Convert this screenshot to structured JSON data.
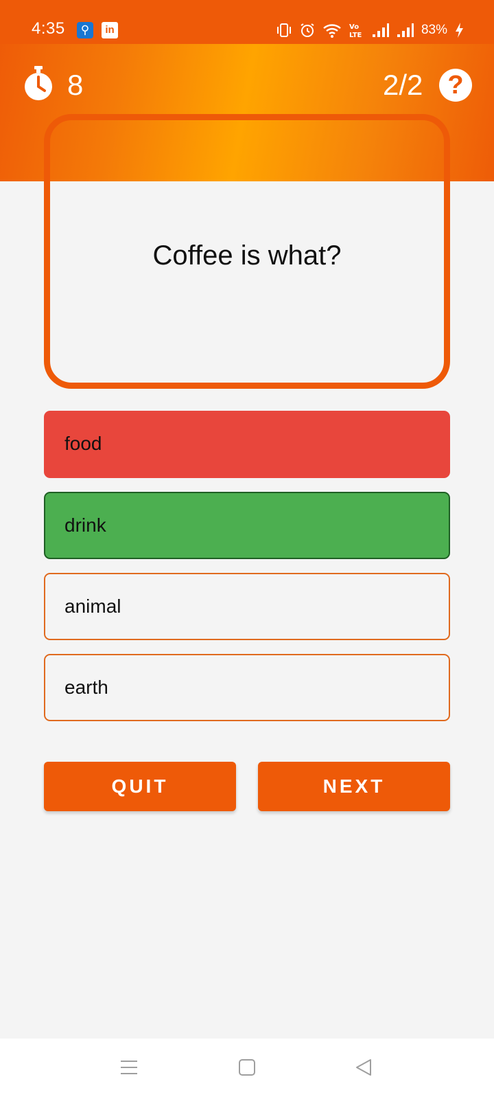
{
  "status_bar": {
    "time": "4:35",
    "battery": "83%",
    "icons": [
      "usb-debug-icon",
      "linkedin-icon",
      "vibrate-icon",
      "alarm-icon",
      "wifi-icon",
      "volte-icon",
      "signal-icon",
      "signal-icon",
      "charging-icon"
    ]
  },
  "quiz": {
    "timer_value": "8",
    "progress": "2/2",
    "help_label": "?",
    "question": "Coffee is what?",
    "options": [
      {
        "label": "food",
        "state": "wrong"
      },
      {
        "label": "drink",
        "state": "correct"
      },
      {
        "label": "animal",
        "state": "default"
      },
      {
        "label": "earth",
        "state": "default"
      }
    ],
    "quit_label": "QUIT",
    "next_label": "NEXT"
  },
  "colors": {
    "accent": "#ee5a08",
    "wrong": "#e8463c",
    "correct": "#4caf50",
    "background": "#f4f4f4"
  },
  "nav_bar": {
    "icons": [
      "menu-icon",
      "home-icon",
      "back-icon"
    ]
  }
}
